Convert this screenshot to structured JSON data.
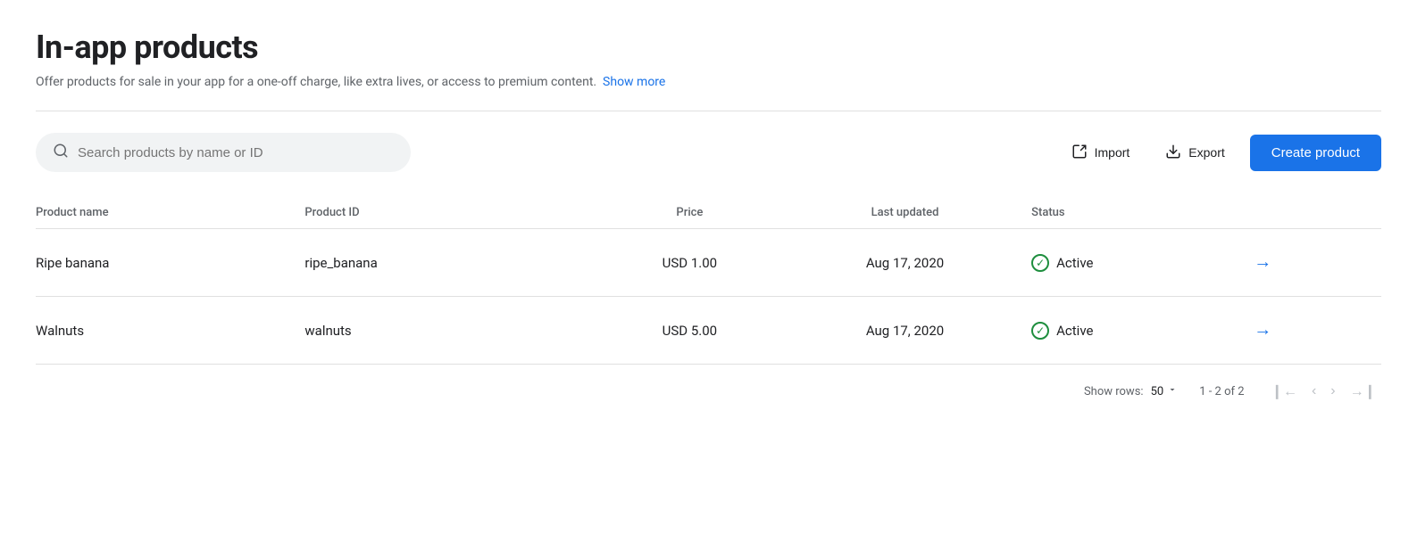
{
  "page": {
    "title": "In-app products",
    "subtitle": "Offer products for sale in your app for a one-off charge, like extra lives, or access to premium content.",
    "show_more_label": "Show more"
  },
  "toolbar": {
    "search_placeholder": "Search products by name or ID",
    "import_label": "Import",
    "export_label": "Export",
    "create_label": "Create product"
  },
  "table": {
    "columns": [
      {
        "key": "name",
        "label": "Product name"
      },
      {
        "key": "id",
        "label": "Product ID"
      },
      {
        "key": "price",
        "label": "Price"
      },
      {
        "key": "last_updated",
        "label": "Last updated"
      },
      {
        "key": "status",
        "label": "Status"
      }
    ],
    "rows": [
      {
        "name": "Ripe banana",
        "product_id": "ripe_banana",
        "price": "USD 1.00",
        "last_updated": "Aug 17, 2020",
        "status": "Active"
      },
      {
        "name": "Walnuts",
        "product_id": "walnuts",
        "price": "USD 5.00",
        "last_updated": "Aug 17, 2020",
        "status": "Active"
      }
    ]
  },
  "footer": {
    "show_rows_label": "Show rows:",
    "rows_per_page": "50",
    "pagination_info": "1 - 2 of 2"
  }
}
